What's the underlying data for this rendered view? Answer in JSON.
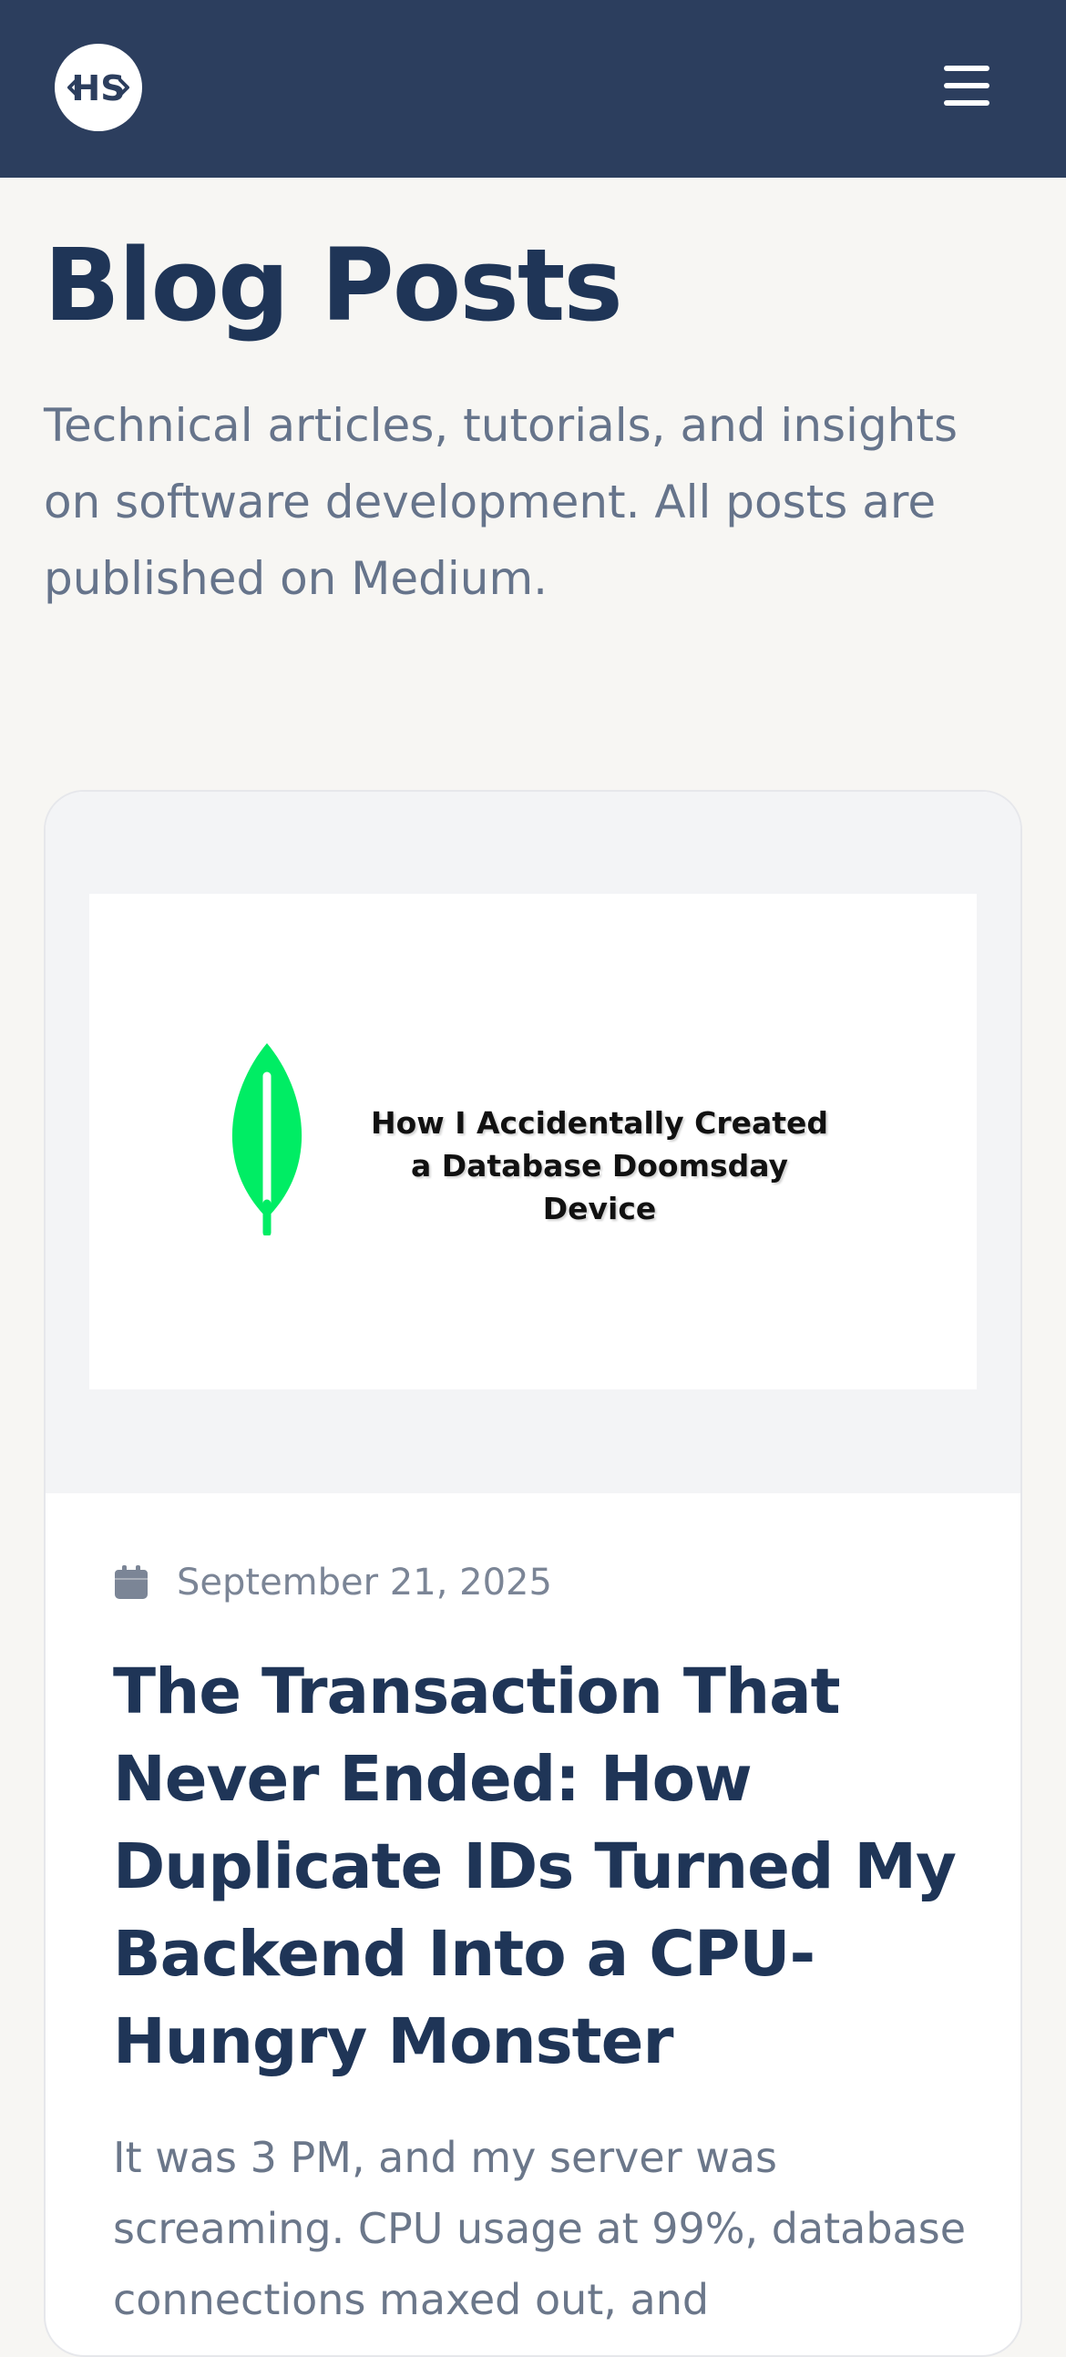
{
  "header": {
    "logo_text": "HS",
    "menu_icon": "hamburger-menu-icon",
    "background_color": "#2c3e5e"
  },
  "page": {
    "title": "Blog Posts",
    "subtitle": "Technical articles, tutorials, and insights on software development. All posts are published on Medium."
  },
  "posts": [
    {
      "thumbnail": {
        "icon": "mongodb-leaf-icon",
        "line1": "How I Accidentally Created",
        "line2": "a Database Doomsday Device",
        "leaf_color": "#00ed64"
      },
      "date": "September 21, 2025",
      "title": "The Transaction That Never Ended: How Duplicate IDs Turned My Backend Into a CPU-Hungry Monster",
      "excerpt": "It was 3 PM, and my server was screaming. CPU usage at 99%, database connections maxed out, and"
    }
  ]
}
